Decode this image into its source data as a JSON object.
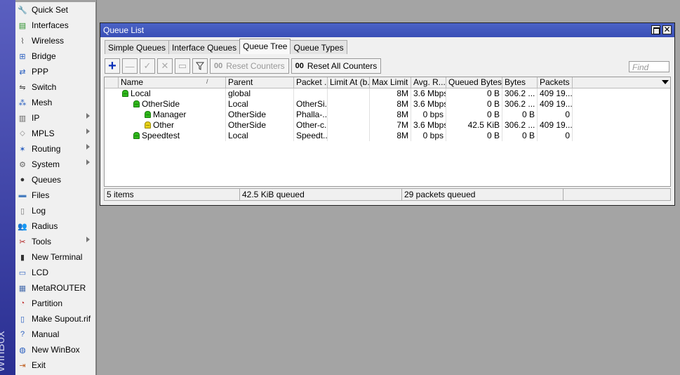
{
  "brand": {
    "strip_text": "WinBox"
  },
  "menu": [
    {
      "label": "Quick Set",
      "icon": "quick-set-icon",
      "submenu": false
    },
    {
      "label": "Interfaces",
      "icon": "interfaces-icon",
      "submenu": false
    },
    {
      "label": "Wireless",
      "icon": "wireless-icon",
      "submenu": false
    },
    {
      "label": "Bridge",
      "icon": "bridge-icon",
      "submenu": false
    },
    {
      "label": "PPP",
      "icon": "ppp-icon",
      "submenu": false
    },
    {
      "label": "Switch",
      "icon": "switch-icon",
      "submenu": false
    },
    {
      "label": "Mesh",
      "icon": "mesh-icon",
      "submenu": false
    },
    {
      "label": "IP",
      "icon": "ip-icon",
      "submenu": true
    },
    {
      "label": "MPLS",
      "icon": "mpls-icon",
      "submenu": true
    },
    {
      "label": "Routing",
      "icon": "routing-icon",
      "submenu": true
    },
    {
      "label": "System",
      "icon": "system-icon",
      "submenu": true
    },
    {
      "label": "Queues",
      "icon": "queues-icon",
      "submenu": false
    },
    {
      "label": "Files",
      "icon": "files-icon",
      "submenu": false
    },
    {
      "label": "Log",
      "icon": "log-icon",
      "submenu": false
    },
    {
      "label": "Radius",
      "icon": "radius-icon",
      "submenu": false
    },
    {
      "label": "Tools",
      "icon": "tools-icon",
      "submenu": true
    },
    {
      "label": "New Terminal",
      "icon": "terminal-icon",
      "submenu": false
    },
    {
      "label": "LCD",
      "icon": "lcd-icon",
      "submenu": false
    },
    {
      "label": "MetaROUTER",
      "icon": "metarouter-icon",
      "submenu": false
    },
    {
      "label": "Partition",
      "icon": "partition-icon",
      "submenu": false
    },
    {
      "label": "Make Supout.rif",
      "icon": "supout-icon",
      "submenu": false
    },
    {
      "label": "Manual",
      "icon": "manual-icon",
      "submenu": false
    },
    {
      "label": "New WinBox",
      "icon": "new-winbox-icon",
      "submenu": false
    },
    {
      "label": "Exit",
      "icon": "exit-icon",
      "submenu": false
    }
  ],
  "window": {
    "title": "Queue List",
    "tabs": [
      {
        "label": "Simple Queues",
        "active": false
      },
      {
        "label": "Interface Queues",
        "active": false
      },
      {
        "label": "Queue Tree",
        "active": true
      },
      {
        "label": "Queue Types",
        "active": false
      }
    ],
    "toolbar": {
      "reset_counters": "Reset Counters",
      "reset_all_counters": "Reset All Counters",
      "counter_glyph": "00",
      "find_placeholder": "Find"
    },
    "columns": [
      "Name",
      "Parent",
      "Packet ...",
      "Limit At (b...",
      "Max Limit ...",
      "Avg. R...",
      "Queued Bytes",
      "Bytes",
      "Packets"
    ],
    "rows": [
      {
        "name": "Local",
        "indent": 0,
        "icon_color": "green",
        "parent": "global",
        "packet_mark": "",
        "limit_at": "",
        "max_limit": "8M",
        "avg_rate": "3.6 Mbps",
        "queued_bytes": "0 B",
        "bytes": "306.2 ...",
        "packets": "409 19..."
      },
      {
        "name": "OtherSide",
        "indent": 1,
        "icon_color": "green",
        "parent": "Local",
        "packet_mark": "OtherSi...",
        "limit_at": "",
        "max_limit": "8M",
        "avg_rate": "3.6 Mbps",
        "queued_bytes": "0 B",
        "bytes": "306.2 ...",
        "packets": "409 19..."
      },
      {
        "name": "Manager",
        "indent": 2,
        "icon_color": "green",
        "parent": "OtherSide",
        "packet_mark": "Phalla-...",
        "limit_at": "",
        "max_limit": "8M",
        "avg_rate": "0 bps",
        "queued_bytes": "0 B",
        "bytes": "0 B",
        "packets": "0"
      },
      {
        "name": "Other",
        "indent": 2,
        "icon_color": "yellow",
        "parent": "OtherSide",
        "packet_mark": "Other-c...",
        "limit_at": "",
        "max_limit": "7M",
        "avg_rate": "3.6 Mbps",
        "queued_bytes": "42.5 KiB",
        "bytes": "306.2 ...",
        "packets": "409 19..."
      },
      {
        "name": "Speedtest",
        "indent": 1,
        "icon_color": "green",
        "parent": "Local",
        "packet_mark": "Speedt...",
        "limit_at": "",
        "max_limit": "8M",
        "avg_rate": "0 bps",
        "queued_bytes": "0 B",
        "bytes": "0 B",
        "packets": "0"
      }
    ],
    "status": {
      "items": "5 items",
      "queued": "42.5 KiB queued",
      "packets_queued": "29 packets queued"
    }
  }
}
